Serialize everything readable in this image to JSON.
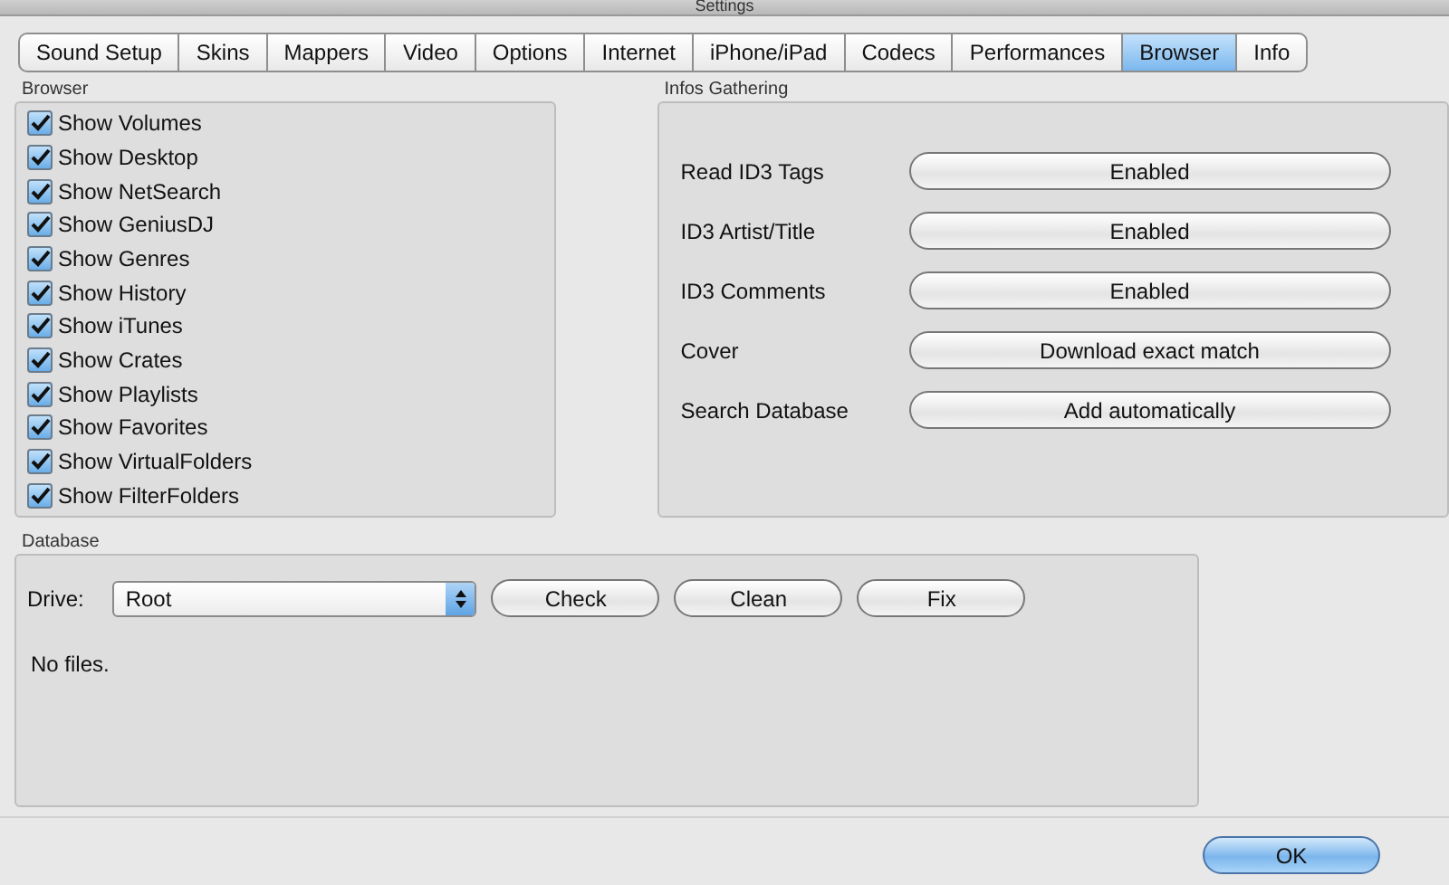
{
  "window": {
    "title": "Settings"
  },
  "tabs": [
    {
      "label": "Sound Setup",
      "selected": false
    },
    {
      "label": "Skins",
      "selected": false
    },
    {
      "label": "Mappers",
      "selected": false
    },
    {
      "label": "Video",
      "selected": false
    },
    {
      "label": "Options",
      "selected": false
    },
    {
      "label": "Internet",
      "selected": false
    },
    {
      "label": "iPhone/iPad",
      "selected": false
    },
    {
      "label": "Codecs",
      "selected": false
    },
    {
      "label": "Performances",
      "selected": false
    },
    {
      "label": "Browser",
      "selected": true
    },
    {
      "label": "Info",
      "selected": false
    }
  ],
  "browser": {
    "title": "Browser",
    "items": [
      {
        "label": "Show Volumes",
        "checked": true
      },
      {
        "label": "Show Desktop",
        "checked": true
      },
      {
        "label": "Show NetSearch",
        "checked": true
      },
      {
        "label": "Show GeniusDJ",
        "checked": true
      },
      {
        "label": "Show Genres",
        "checked": true
      },
      {
        "label": "Show History",
        "checked": true
      },
      {
        "label": "Show iTunes",
        "checked": true
      },
      {
        "label": "Show Crates",
        "checked": true
      },
      {
        "label": "Show Playlists",
        "checked": true
      },
      {
        "label": "Show Favorites",
        "checked": true
      },
      {
        "label": "Show VirtualFolders",
        "checked": true
      },
      {
        "label": "Show FilterFolders",
        "checked": true
      }
    ]
  },
  "infos": {
    "title": "Infos Gathering",
    "rows": [
      {
        "label": "Read ID3 Tags",
        "value": "Enabled"
      },
      {
        "label": "ID3 Artist/Title",
        "value": "Enabled"
      },
      {
        "label": "ID3 Comments",
        "value": "Enabled"
      },
      {
        "label": "Cover",
        "value": "Download exact match"
      },
      {
        "label": "Search Database",
        "value": "Add automatically"
      }
    ]
  },
  "database": {
    "title": "Database",
    "drive_label": "Drive:",
    "drive": "Root",
    "buttons": [
      "Check",
      "Clean",
      "Fix"
    ],
    "status": "No files."
  },
  "ok_button": "OK"
}
